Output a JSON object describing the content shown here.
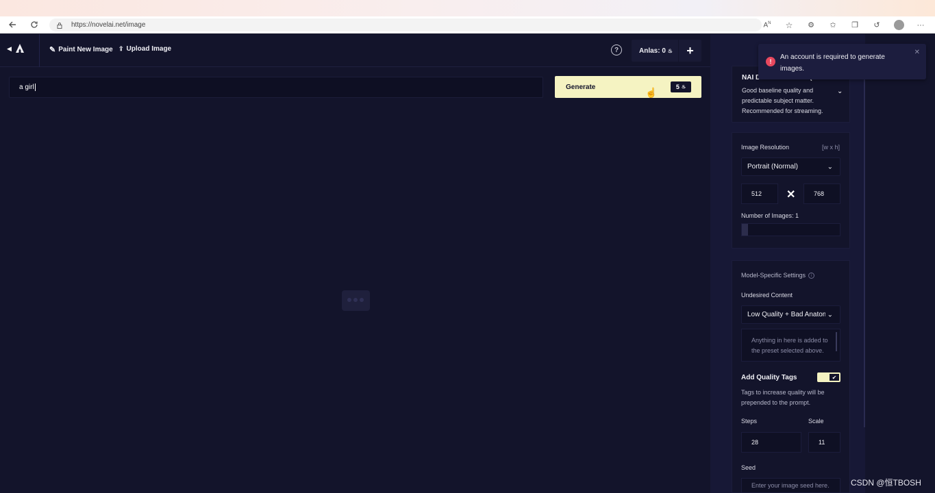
{
  "browser": {
    "url": "https://novelai.net/image"
  },
  "header": {
    "paint_label": "Paint New Image",
    "upload_label": "Upload Image",
    "anlas_label": "Anlas:",
    "anlas_value": "0"
  },
  "prompt": {
    "value": "a girl",
    "generate_label": "Generate",
    "cost": "5"
  },
  "toast": {
    "message": "An account is required to generate images."
  },
  "model": {
    "title": "NAI Diffusion Anime (Curated)",
    "description": "Good baseline quality and predictable subject matter. Recommended for streaming."
  },
  "resolution": {
    "label": "Image Resolution",
    "hint": "[w x h]",
    "preset": "Portrait (Normal)",
    "width": "512",
    "height": "768"
  },
  "images": {
    "label": "Number of Images:",
    "value": "1",
    "slider_fraction": 0.06
  },
  "model_settings": {
    "label": "Model-Specific Settings",
    "undesired_label": "Undesired Content",
    "undesired_preset": "Low Quality + Bad Anatomy",
    "undesired_placeholder": "Anything in here is added to the preset selected above."
  },
  "quality_tags": {
    "label": "Add Quality Tags",
    "enabled": true,
    "description": "Tags to increase quality will be prepended to the prompt."
  },
  "steps": {
    "label": "Steps",
    "value": "28"
  },
  "scale": {
    "label": "Scale",
    "value": "11"
  },
  "seed": {
    "label": "Seed",
    "placeholder": "Enter your image seed here."
  },
  "watermark": "CSDN @恒TBOSH",
  "colors": {
    "background": "#13142b",
    "accent": "#f5f3c2",
    "error": "#e8485e"
  }
}
